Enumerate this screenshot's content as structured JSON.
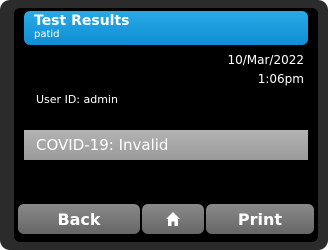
{
  "header": {
    "title": "Test Results",
    "subtitle": "patid"
  },
  "info": {
    "date": "10/Mar/2022",
    "time": "1:06pm",
    "user_id": "User ID: admin"
  },
  "result": {
    "text": "COVID-19: Invalid"
  },
  "buttons": {
    "back_label": "Back",
    "home_icon": "home-icon",
    "print_label": "Print"
  },
  "colors": {
    "header_blue": "#1a9be0",
    "screen_bg": "#000000",
    "result_bar": "#a8a8a8",
    "button_gray": "#777777"
  }
}
